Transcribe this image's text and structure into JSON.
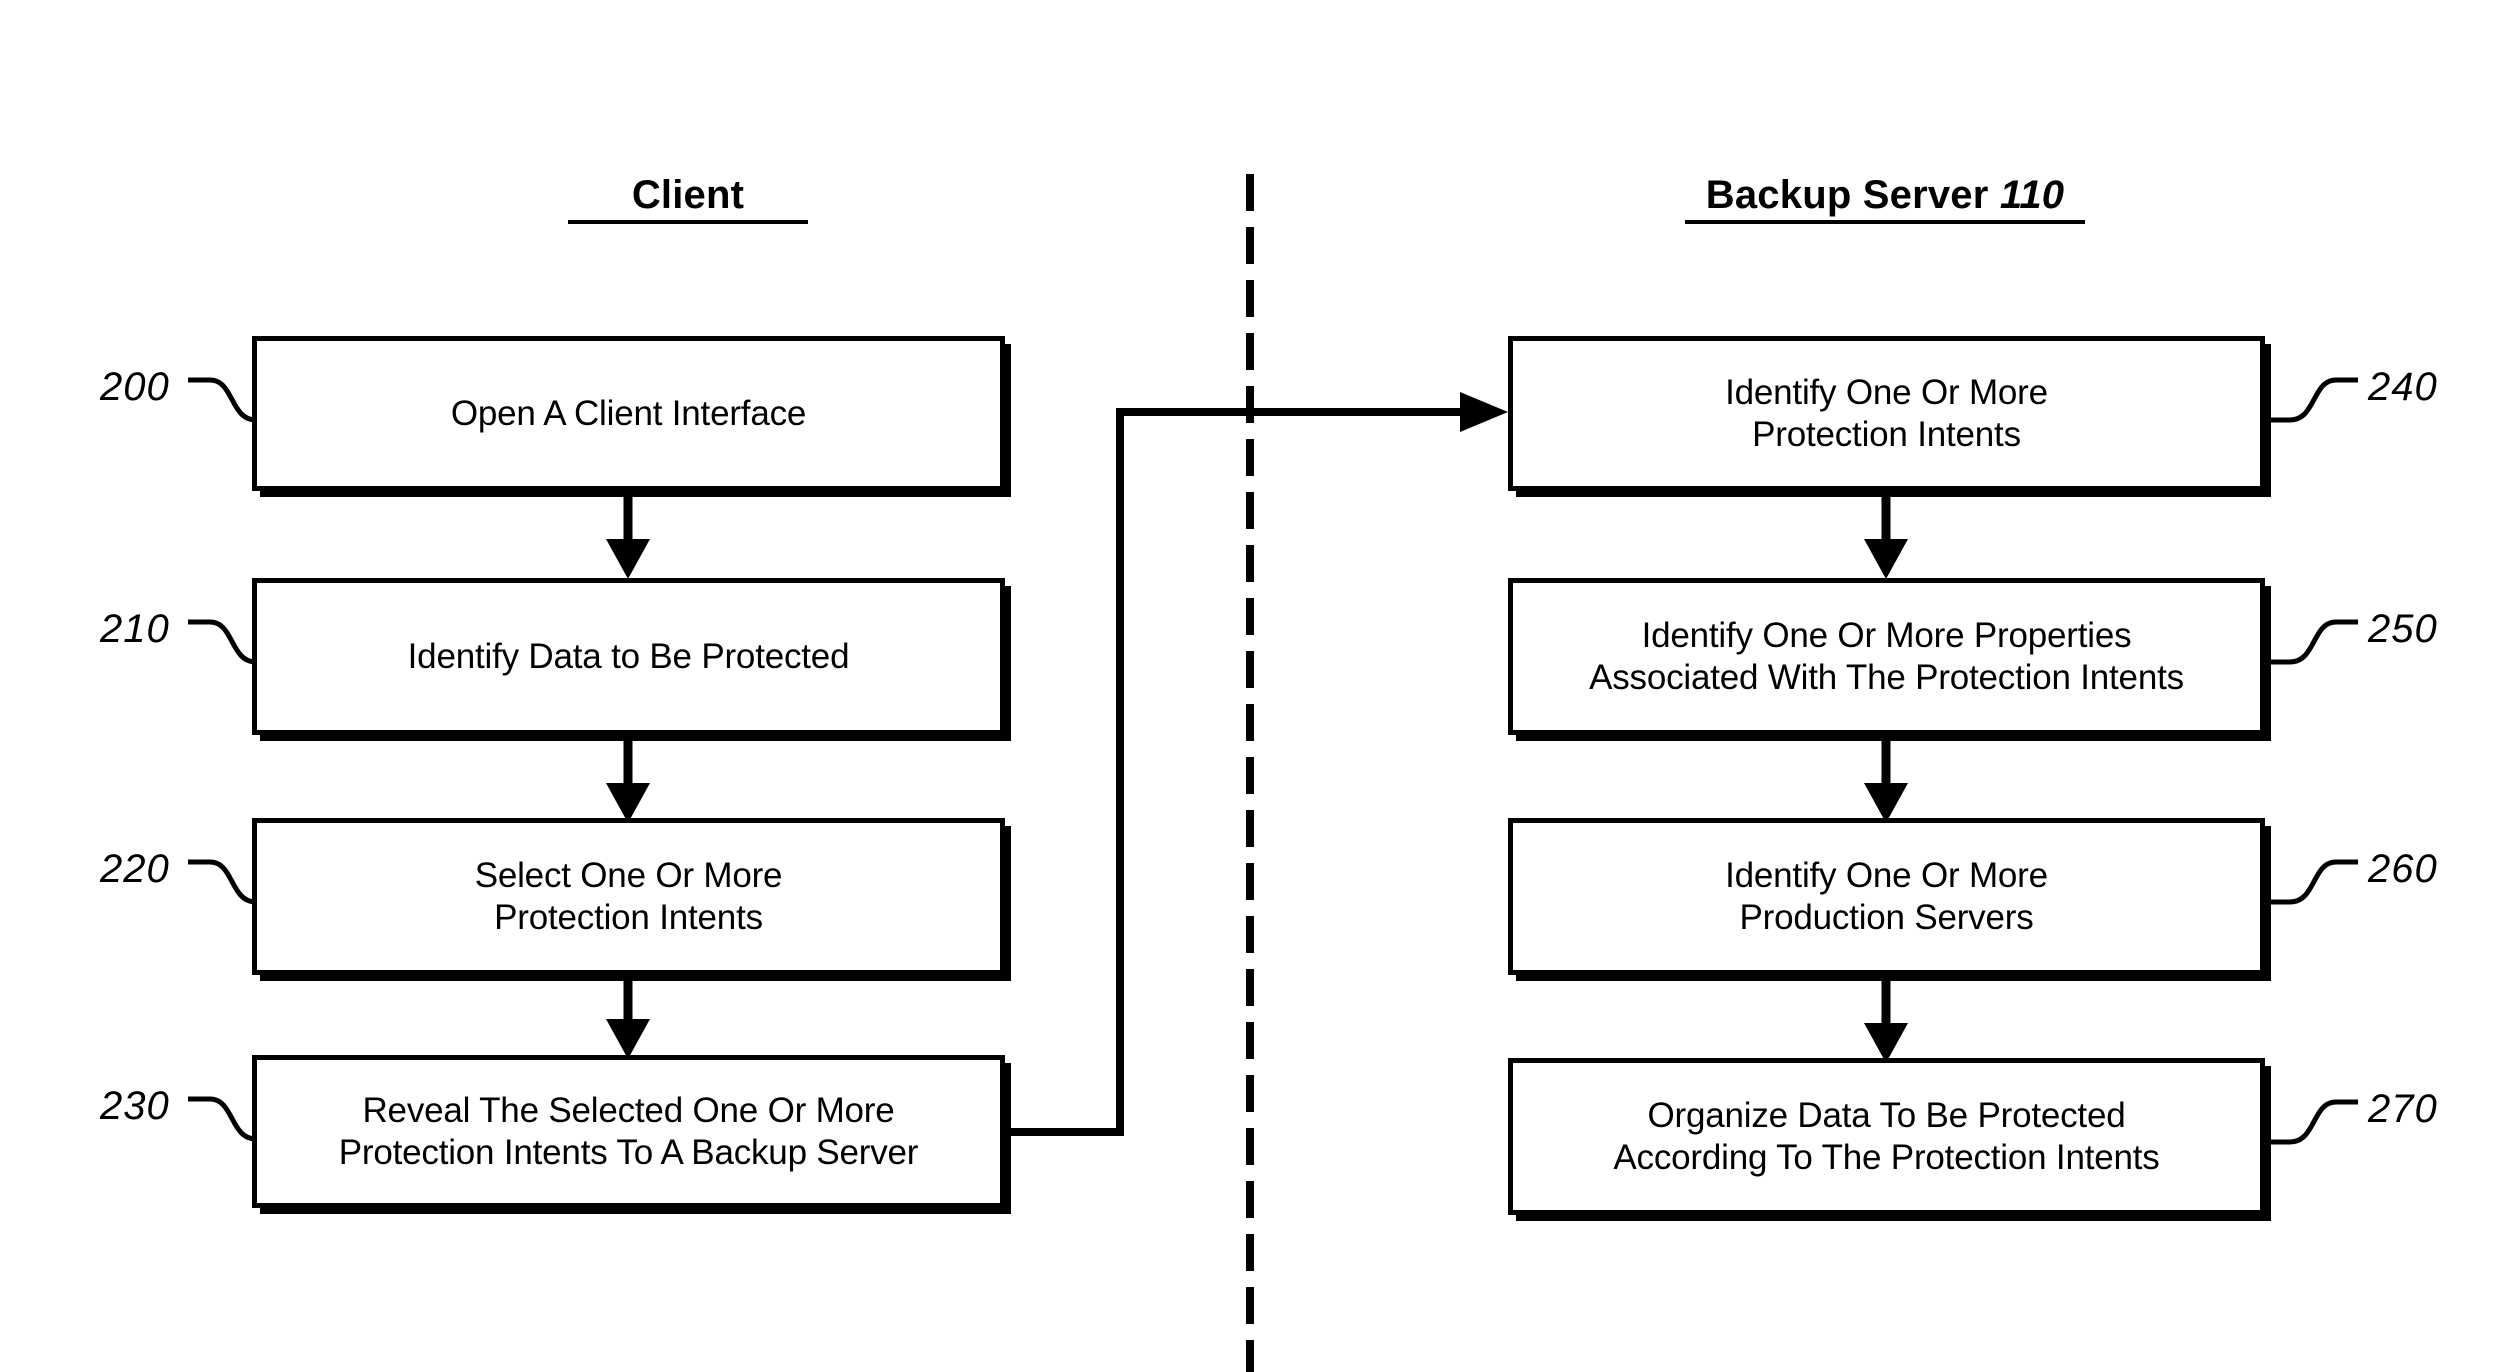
{
  "figure": {
    "columns": [
      {
        "id": "client",
        "heading": "Client",
        "heading_ref": ""
      },
      {
        "id": "backup_server",
        "heading": "Backup Server ",
        "heading_ref": "110"
      }
    ],
    "client_steps": [
      {
        "ref": "200",
        "text": "Open A Client Interface"
      },
      {
        "ref": "210",
        "text": "Identify Data to Be Protected"
      },
      {
        "ref": "220",
        "text": "Select One Or More\nProtection Intents"
      },
      {
        "ref": "230",
        "text": "Reveal The Selected One Or More\nProtection Intents To A Backup Server"
      }
    ],
    "server_steps": [
      {
        "ref": "240",
        "text": "Identify One Or More\nProtection Intents"
      },
      {
        "ref": "250",
        "text": "Identify One Or More Properties\nAssociated With The Protection Intents"
      },
      {
        "ref": "260",
        "text": "Identify One Or More\nProduction Servers"
      },
      {
        "ref": "270",
        "text": "Organize Data To Be Protected\nAccording To The Protection Intents"
      }
    ],
    "colors": {
      "ink": "#000000",
      "paper": "#ffffff"
    }
  }
}
